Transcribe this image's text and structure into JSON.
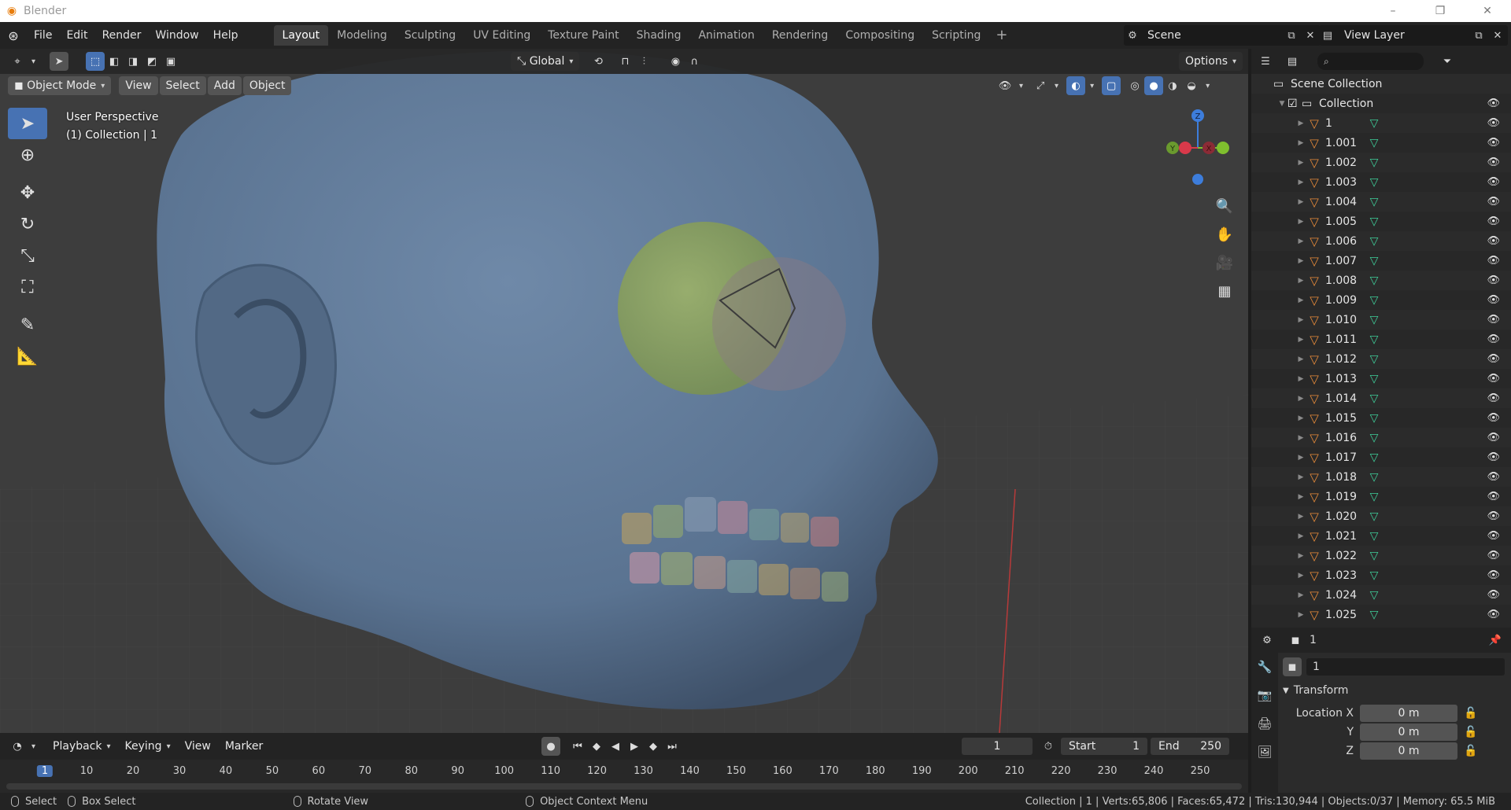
{
  "window": {
    "title": "Blender",
    "controls": [
      "–",
      "❐",
      "✕"
    ]
  },
  "menu": [
    "File",
    "Edit",
    "Render",
    "Window",
    "Help"
  ],
  "workspaces": [
    {
      "label": "Layout",
      "active": true
    },
    {
      "label": "Modeling"
    },
    {
      "label": "Sculpting"
    },
    {
      "label": "UV Editing"
    },
    {
      "label": "Texture Paint"
    },
    {
      "label": "Shading"
    },
    {
      "label": "Animation"
    },
    {
      "label": "Rendering"
    },
    {
      "label": "Compositing"
    },
    {
      "label": "Scripting"
    }
  ],
  "scene": {
    "name": "Scene",
    "view_layer": "View Layer"
  },
  "viewport_header": {
    "transform_orientation": "Global",
    "options_label": "Options",
    "mode": "Object Mode",
    "menus": [
      "View",
      "Select",
      "Add",
      "Object"
    ]
  },
  "viewport_info": {
    "line1": "User Perspective",
    "line2": "(1) Collection | 1"
  },
  "gizmo": {
    "z": "Z",
    "y": "Y",
    "x": "X"
  },
  "outliner": {
    "scene_collection": "Scene Collection",
    "collection": "Collection",
    "objects": [
      "1",
      "1.001",
      "1.002",
      "1.003",
      "1.004",
      "1.005",
      "1.006",
      "1.007",
      "1.008",
      "1.009",
      "1.010",
      "1.011",
      "1.012",
      "1.013",
      "1.014",
      "1.015",
      "1.016",
      "1.017",
      "1.018",
      "1.019",
      "1.020",
      "1.021",
      "1.022",
      "1.023",
      "1.024",
      "1.025"
    ]
  },
  "properties": {
    "object_name": "1",
    "name_field": "1",
    "panel_title": "Transform",
    "location_x_label": "Location X",
    "location_y_label": "Y",
    "location_z_label": "Z",
    "location_x": "0 m",
    "location_y": "0 m",
    "location_z": "0 m"
  },
  "timeline": {
    "menus": [
      "Playback",
      "Keying",
      "View",
      "Marker"
    ],
    "current_frame": "1",
    "start_label": "Start",
    "start": "1",
    "end_label": "End",
    "end": "250",
    "ruler": [
      "1",
      "10",
      "20",
      "30",
      "40",
      "50",
      "60",
      "70",
      "80",
      "90",
      "100",
      "110",
      "120",
      "130",
      "140",
      "150",
      "160",
      "170",
      "180",
      "190",
      "200",
      "210",
      "220",
      "230",
      "240",
      "250"
    ]
  },
  "statusbar": {
    "select": "Select",
    "box_select": "Box Select",
    "rotate_view": "Rotate View",
    "context_menu": "Object Context Menu",
    "stats": "Collection | 1 | Verts:65,806 | Faces:65,472 | Tris:130,944 | Objects:0/37 | Memory: 65.5 MiB"
  },
  "colors": {
    "accent": "#4772b3",
    "object_icon": "#e88b3a",
    "mesh_icon": "#3fcf9a",
    "head_mesh": "#5f7a99"
  }
}
